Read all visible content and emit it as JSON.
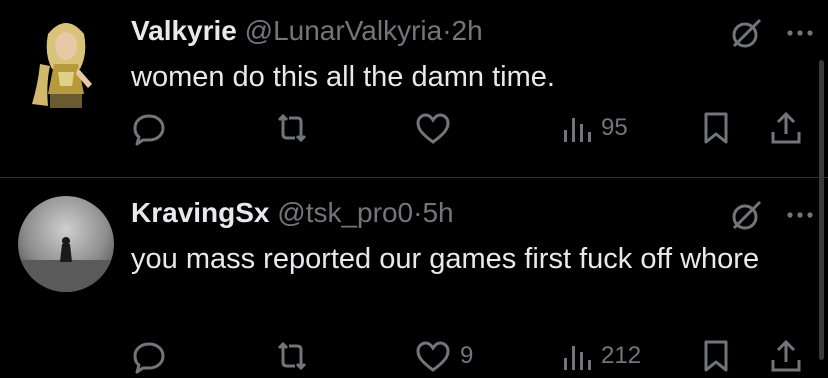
{
  "tweets": [
    {
      "name": "Valkyrie",
      "handle": "@LunarValkyria",
      "sep": "·",
      "time": "2h",
      "text": "women do this all the damn time.",
      "replies": "",
      "retweets": "",
      "likes": "",
      "views": "95"
    },
    {
      "name": "KravingSx",
      "handle": "@tsk_pro0",
      "sep": "·",
      "time": "5h",
      "text": "you mass reported our games first fuck off whore",
      "replies": "",
      "retweets": "",
      "likes": "9",
      "views": "212"
    }
  ],
  "colors": {
    "background": "#000000",
    "text": "#e7e9ea",
    "muted": "#71767b",
    "divider": "#2f3336"
  },
  "icons": [
    "reply-icon",
    "retweet-icon",
    "like-icon",
    "views-icon",
    "bookmark-icon",
    "share-icon",
    "grok-icon",
    "more-icon"
  ]
}
